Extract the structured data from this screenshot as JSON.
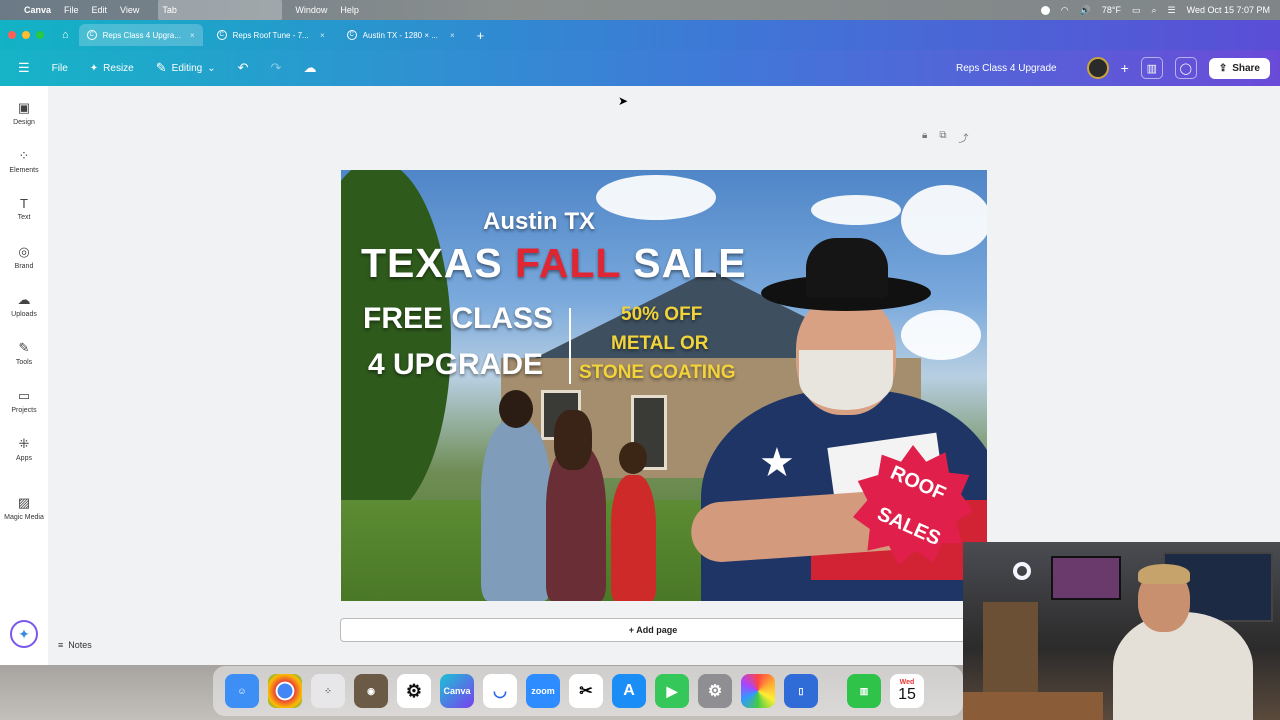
{
  "menubar": {
    "app": "Canva",
    "items": [
      "File",
      "Edit",
      "View",
      "Tab",
      "Window",
      "Help"
    ],
    "weather": "78°F",
    "datetime": "Wed Oct 15  7:07 PM"
  },
  "browser_tabs": [
    {
      "title": "Reps Class 4 Upgra...",
      "active": true
    },
    {
      "title": "Reps Roof Tune - 7...",
      "active": false
    },
    {
      "title": "Austin TX - 1280 × ...",
      "active": false
    }
  ],
  "toolbar": {
    "file": "File",
    "resize": "Resize",
    "editing": "Editing",
    "design_name": "Reps Class 4 Upgrade",
    "share": "Share"
  },
  "sidebar": [
    {
      "label": "Design",
      "icon": "design-icon"
    },
    {
      "label": "Elements",
      "icon": "elements-icon"
    },
    {
      "label": "Text",
      "icon": "text-icon"
    },
    {
      "label": "Brand",
      "icon": "brand-icon"
    },
    {
      "label": "Uploads",
      "icon": "uploads-icon"
    },
    {
      "label": "Tools",
      "icon": "tools-icon"
    },
    {
      "label": "Projects",
      "icon": "projects-icon"
    },
    {
      "label": "Apps",
      "icon": "apps-icon"
    },
    {
      "label": "Magic Media",
      "icon": "magic-media-icon"
    }
  ],
  "canvas": {
    "line1": "Austin TX",
    "line2_a": "TEXAS ",
    "line2_b": "FALL",
    "line2_c": " SALE",
    "left1": "FREE CLASS",
    "left2": "4 UPGRADE",
    "right1": "50% OFF",
    "right2": "METAL OR",
    "right3": "STONE COATING",
    "badge1": "ROOF",
    "badge2": "SALES"
  },
  "add_page": "+ Add page",
  "notes": "Notes",
  "dock": {
    "apps": [
      "Finder",
      "Chrome",
      "Launchpad",
      "App",
      "ChatGPT",
      "Canva",
      "App",
      "Zoom",
      "CapCut",
      "App Store",
      "FaceTime",
      "Settings",
      "Photos",
      "Simulator",
      "Numbers",
      "Calendar"
    ],
    "calendar_day": "Wed",
    "calendar_date": "15"
  },
  "colors": {
    "accent_teal": "#12b3c5",
    "accent_purple": "#6a4bd8",
    "fall_red": "#e02632",
    "yellow": "#f2d33a"
  }
}
